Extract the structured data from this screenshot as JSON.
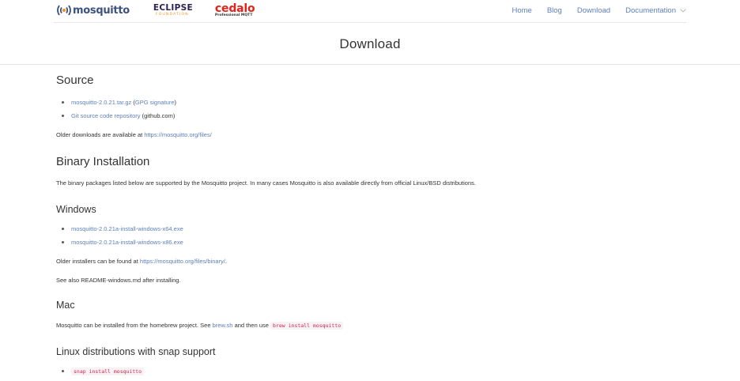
{
  "brand": {
    "mosquitto_logo": "mosquitto",
    "eclipse_logo": "ECLIPSE",
    "eclipse_sub": "FOUNDATION",
    "cedalo_logo": "cedalo",
    "cedalo_sub": "Professional MQTT"
  },
  "nav": {
    "home": "Home",
    "blog": "Blog",
    "download": "Download",
    "documentation": "Documentation"
  },
  "page": {
    "title": "Download"
  },
  "source": {
    "heading": "Source",
    "tarball": "mosquitto-2.0.21.tar.gz",
    "gpg_open": "(",
    "gpg": "GPG signature",
    "gpg_close": ")",
    "git": "Git source code repository",
    "git_note": "(github.com)",
    "older_text": "Older downloads are available at",
    "older_link": "https://mosquitto.org/files/"
  },
  "binary": {
    "heading": "Binary Installation",
    "text": "The binary packages listed below are supported by the Mosquitto project. In many cases Mosquitto is also available directly from official Linux/BSD distributions."
  },
  "windows": {
    "heading": "Windows",
    "x64": "mosquitto-2.0.21a-install-windows-x64.exe",
    "x86": "mosquitto-2.0.21a-install-windows-x86.exe",
    "older_text": "Older installers can be found at",
    "older_link": "https://mosquitto.org/files/binary/",
    "older_end": ".",
    "readme": "See also README-windows.md after installing."
  },
  "mac": {
    "heading": "Mac",
    "text": "Mosquitto can be installed from the homebrew project. See",
    "brew_link": "brew.sh",
    "text2": "and then use",
    "command": "brew install mosquitto"
  },
  "linux": {
    "heading": "Linux distributions with snap support",
    "command": "snap install mosquitto"
  },
  "colors": {
    "link": "#5b7fb9",
    "code": "#c7254e",
    "code_bg": "#f9f2f4",
    "cedalo": "#e2231a",
    "eclipse_sub": "#f7941e"
  }
}
